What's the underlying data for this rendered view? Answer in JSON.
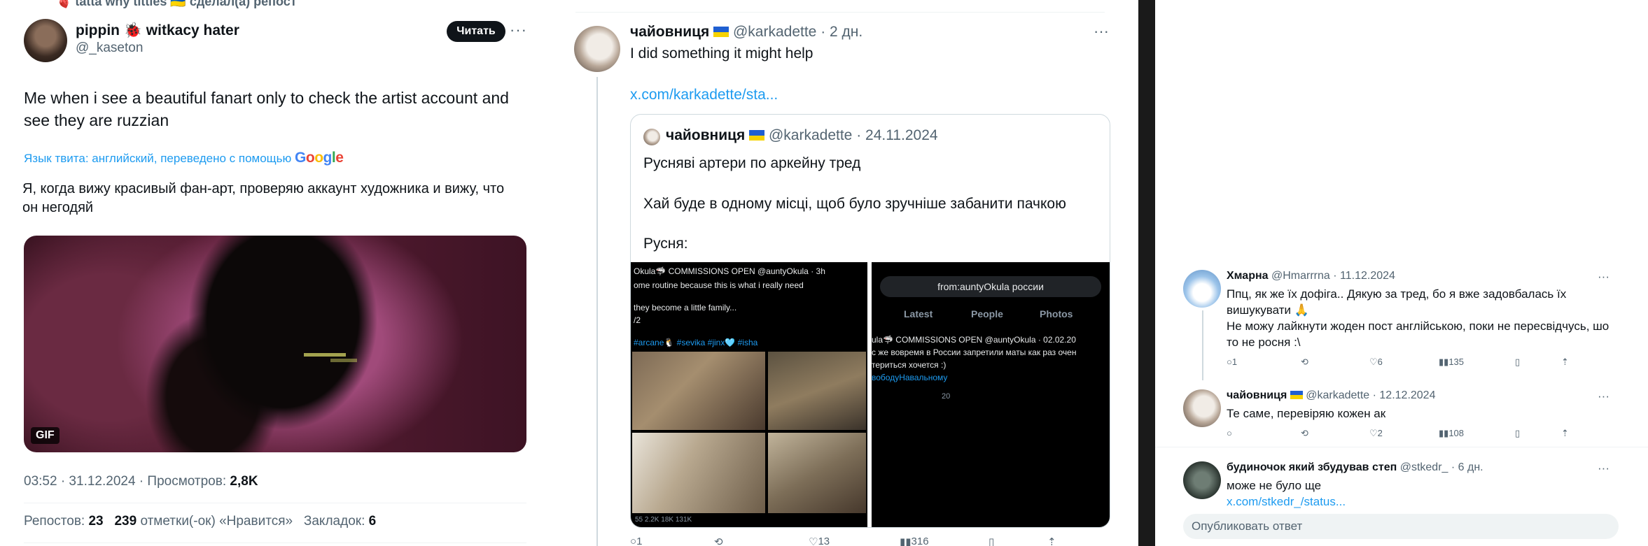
{
  "left_tweet": {
    "repost_line": "🫀 tatta why titties 🇺🇦 сделал(а) репост",
    "author_name": "pippin 🐞 witkacy hater",
    "author_handle": "@_kaseton",
    "follow_label": "Читать",
    "text": "Me when i see a beautiful fanart only to check the artist account and see they are ruzzian",
    "translation_note": "Язык твита: английский, переведено с помощью",
    "translation_provider": "Google",
    "translated_text": "Я, когда вижу красивый фан-арт, проверяю аккаунт художника и вижу, что он негодяй",
    "media_badge": "GIF",
    "meta": {
      "time_date": "03:52 · 31.12.2024 · Просмотров:",
      "views": "2,8K"
    },
    "stats": {
      "reposts_label": "Репостов:",
      "reposts": "23",
      "likes": "239",
      "likes_label": "отметки(-ок) «Нравится»",
      "bookmarks_label": "Закладок:",
      "bookmarks": "6"
    }
  },
  "middle_tweet": {
    "author_name": "чайовниця",
    "author_handle": "@karkadette",
    "time": "· 2 дн.",
    "text": "I did something it might help",
    "link": "x.com/karkadette/sta...",
    "quote": {
      "author_name": "чайовниця",
      "author_handle": "@karkadette",
      "date": "· 24.11.2024",
      "line1": "Русняві артери по аркейну тред",
      "line2": "Хай буде в одному місці, щоб було зручніше забанити пачкою",
      "line3": "Русня:",
      "shot_a": {
        "header": "Okula🦈 COMMISSIONS OPEN @auntyOkula · 3h",
        "line1": "ome routine because this is what i really need",
        "line2": "they become a little family...",
        "line3": "/2",
        "tags": "#arcane🐧 #sevika #jinx🩵 #isha",
        "footer": "55     2.2K     18K     131K"
      },
      "shot_b": {
        "search": "from:auntyOkula россии",
        "tabs": [
          "Latest",
          "People",
          "Photos"
        ],
        "header": "ula🦈 COMMISSIONS OPEN @auntyOkula · 02.02.20",
        "line1": "с же вовремя в России запретили маты как раз очен",
        "line2": "териться хочется :)",
        "tag": "вободуНавальному",
        "footer": "20"
      }
    },
    "actions": {
      "replies": "1",
      "likes": "13",
      "views": "316"
    }
  },
  "replies": [
    {
      "name": "Хмарна",
      "handle": "@Hmarrrna",
      "date": "· 11.12.2024",
      "text1": "Ппц, як же їх дофіга.. Дякую за тред, бо я вже задовбалась їх вишукувати 🙏",
      "text2": "Не можу лайкнути жоден пост англійською, поки не пересвідчусь, шо то не росня :\\",
      "replies": "1",
      "likes": "6",
      "views": "135"
    },
    {
      "name": "чайовниця",
      "handle": "@karkadette",
      "date": "· 12.12.2024",
      "text1": "Те саме, перевіряю кожен ак",
      "replies": "",
      "likes": "2",
      "views": "108"
    },
    {
      "name": "будиночок який збудував степ",
      "handle": "@stkedr_",
      "date": "· 6 дн.",
      "text1": "може не було ще",
      "link": "x.com/stkedr_/status..."
    }
  ],
  "reply_placeholder": "Опубликовать ответ",
  "colors": {
    "accent": "#1d9bf0",
    "text": "#0f1419",
    "muted": "#536471",
    "border": "#cfd9de"
  }
}
